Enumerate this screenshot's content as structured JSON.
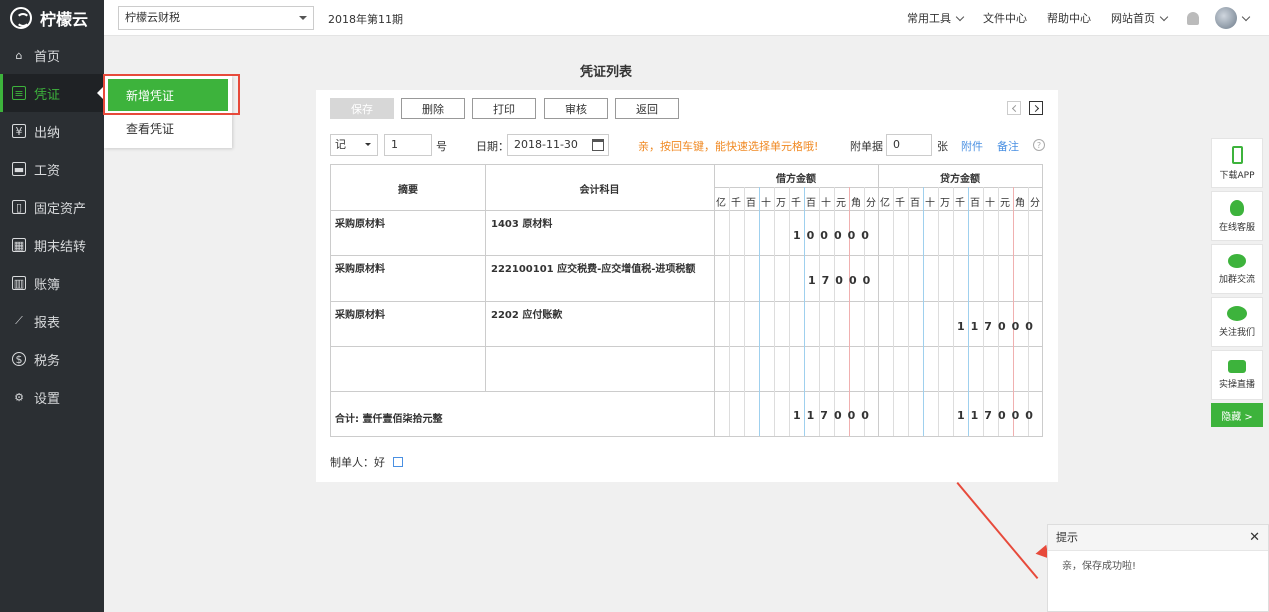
{
  "sidebar": {
    "brand": "柠檬云",
    "items": [
      {
        "label": "首页",
        "icon": "home-icon"
      },
      {
        "label": "凭证",
        "icon": "voucher-icon"
      },
      {
        "label": "出纳",
        "icon": "cashier-icon"
      },
      {
        "label": "工资",
        "icon": "salary-icon"
      },
      {
        "label": "固定资产",
        "icon": "asset-icon"
      },
      {
        "label": "期末结转",
        "icon": "calendar-icon"
      },
      {
        "label": "账簿",
        "icon": "ledger-icon"
      },
      {
        "label": "报表",
        "icon": "chart-icon"
      },
      {
        "label": "税务",
        "icon": "tax-icon"
      },
      {
        "label": "设置",
        "icon": "gear-icon"
      }
    ],
    "active_index": 1,
    "submenu": [
      "新增凭证",
      "查看凭证"
    ]
  },
  "topbar": {
    "company": "柠檬云财税",
    "period": "2018年第11期",
    "links": [
      "常用工具",
      "文件中心",
      "帮助中心",
      "网站首页"
    ]
  },
  "page": {
    "title": "凭证列表"
  },
  "toolbar": {
    "buttons": [
      "保存",
      "删除",
      "打印",
      "审核",
      "返回"
    ]
  },
  "form": {
    "word": "记",
    "number": "1",
    "number_suffix": "号",
    "date_label": "日期：",
    "date": "2018-11-30",
    "tip": "亲，按回车键，能快速选择单元格哦!",
    "tip_color": "#f08a24",
    "attach_label": "附单据",
    "attach_count": "0",
    "attach_unit": "张",
    "attach_link": "附件",
    "remark_link": "备注"
  },
  "voucher": {
    "headers": {
      "summary": "摘要",
      "account": "会计科目",
      "debit": "借方金额",
      "credit": "贷方金额"
    },
    "digit_headers": [
      "亿",
      "千",
      "百",
      "十",
      "万",
      "千",
      "百",
      "十",
      "元",
      "角",
      "分"
    ],
    "rows": [
      {
        "summary": "采购原材料",
        "account": "1403 原材料",
        "debit": "100000",
        "credit": ""
      },
      {
        "summary": "采购原材料",
        "account": "222100101 应交税费-应交增值税-进项税额",
        "debit": "17000",
        "credit": ""
      },
      {
        "summary": "采购原材料",
        "account": "2202 应付账款",
        "debit": "",
        "credit": "117000"
      },
      {
        "summary": "",
        "account": "",
        "debit": "",
        "credit": ""
      }
    ],
    "total_label": "合计: 壹仟壹佰柒拾元整",
    "total_debit": "117000",
    "total_credit": "117000"
  },
  "maker": {
    "label": "制单人：",
    "name": "好"
  },
  "float_bar": {
    "items": [
      "下载APP",
      "在线客服",
      "加群交流",
      "关注我们",
      "实操直播"
    ],
    "hide": "隐藏 >"
  },
  "toast": {
    "title": "提示",
    "message": "亲，保存成功啦!"
  },
  "accent": "#3db33c"
}
